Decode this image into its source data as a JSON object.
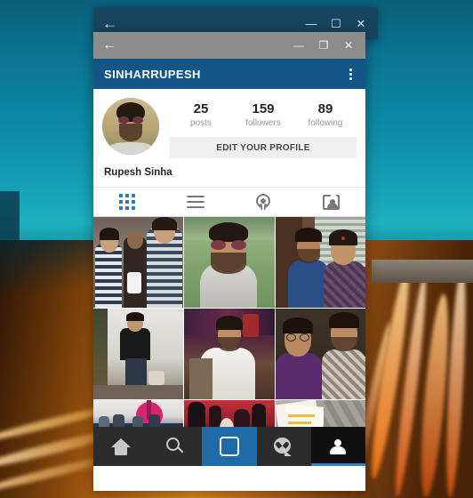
{
  "desktop": {
    "wallpaper_name": "city-skyline-highway-light-trails",
    "sky_color": "#13889c",
    "road_color": "#b86512"
  },
  "outer_window": {
    "back_icon": "←",
    "minimize_label": "—",
    "maximize_label": "☐",
    "close_label": "✕",
    "titlebar_color": "#17455f"
  },
  "inner_window": {
    "back_icon": "←",
    "minimize_label": "—",
    "restore_label": "❐",
    "close_label": "✕",
    "titlebar_color": "#8c8c8c"
  },
  "app": {
    "header": {
      "title": "SINHARRUPESH",
      "background_color": "#125688",
      "overflow_menu_name": "more-options"
    },
    "profile": {
      "avatar_alt": "profile-photo",
      "full_name": "Rupesh Sinha",
      "edit_button_label": "EDIT YOUR PROFILE",
      "stats": [
        {
          "value": "25",
          "label": "posts"
        },
        {
          "value": "159",
          "label": "followers"
        },
        {
          "value": "89",
          "label": "following"
        }
      ]
    },
    "tabs": [
      {
        "name": "grid-view",
        "icon": "grid-icon",
        "active": true,
        "active_color": "#2b7dc4"
      },
      {
        "name": "list-view",
        "icon": "list-icon",
        "active": false
      },
      {
        "name": "photo-map",
        "icon": "location-pin-icon",
        "active": false
      },
      {
        "name": "photos-of-you",
        "icon": "tagged-photos-icon",
        "active": false
      }
    ],
    "photo_grid": {
      "columns": 3,
      "cells": [
        {
          "name": "post-1",
          "alt": "three-friends-mirror-selfie"
        },
        {
          "name": "post-2",
          "alt": "man-with-sunglasses-outdoors"
        },
        {
          "name": "post-3",
          "alt": "man-and-woman-portrait"
        },
        {
          "name": "post-4",
          "alt": "man-in-black-tshirt-standing"
        },
        {
          "name": "post-5",
          "alt": "man-in-white-shirt-seated"
        },
        {
          "name": "post-6",
          "alt": "two-men-smiling-indoors"
        },
        {
          "name": "post-7",
          "alt": "people-at-exhibition-booth"
        },
        {
          "name": "post-8",
          "alt": "crowd-at-concert"
        },
        {
          "name": "post-9",
          "alt": "hands-holding-papers"
        }
      ]
    },
    "bottom_nav": [
      {
        "name": "home",
        "icon": "home-icon",
        "active": false
      },
      {
        "name": "search",
        "icon": "search-icon",
        "active": false
      },
      {
        "name": "camera",
        "icon": "camera-icon",
        "active": true,
        "active_color": "#1d6ca8"
      },
      {
        "name": "activity",
        "icon": "heart-bubble-icon",
        "active": false
      },
      {
        "name": "profile",
        "icon": "person-icon",
        "active": true,
        "active_color": "#111111",
        "underline_color": "#2b83cc"
      }
    ]
  }
}
